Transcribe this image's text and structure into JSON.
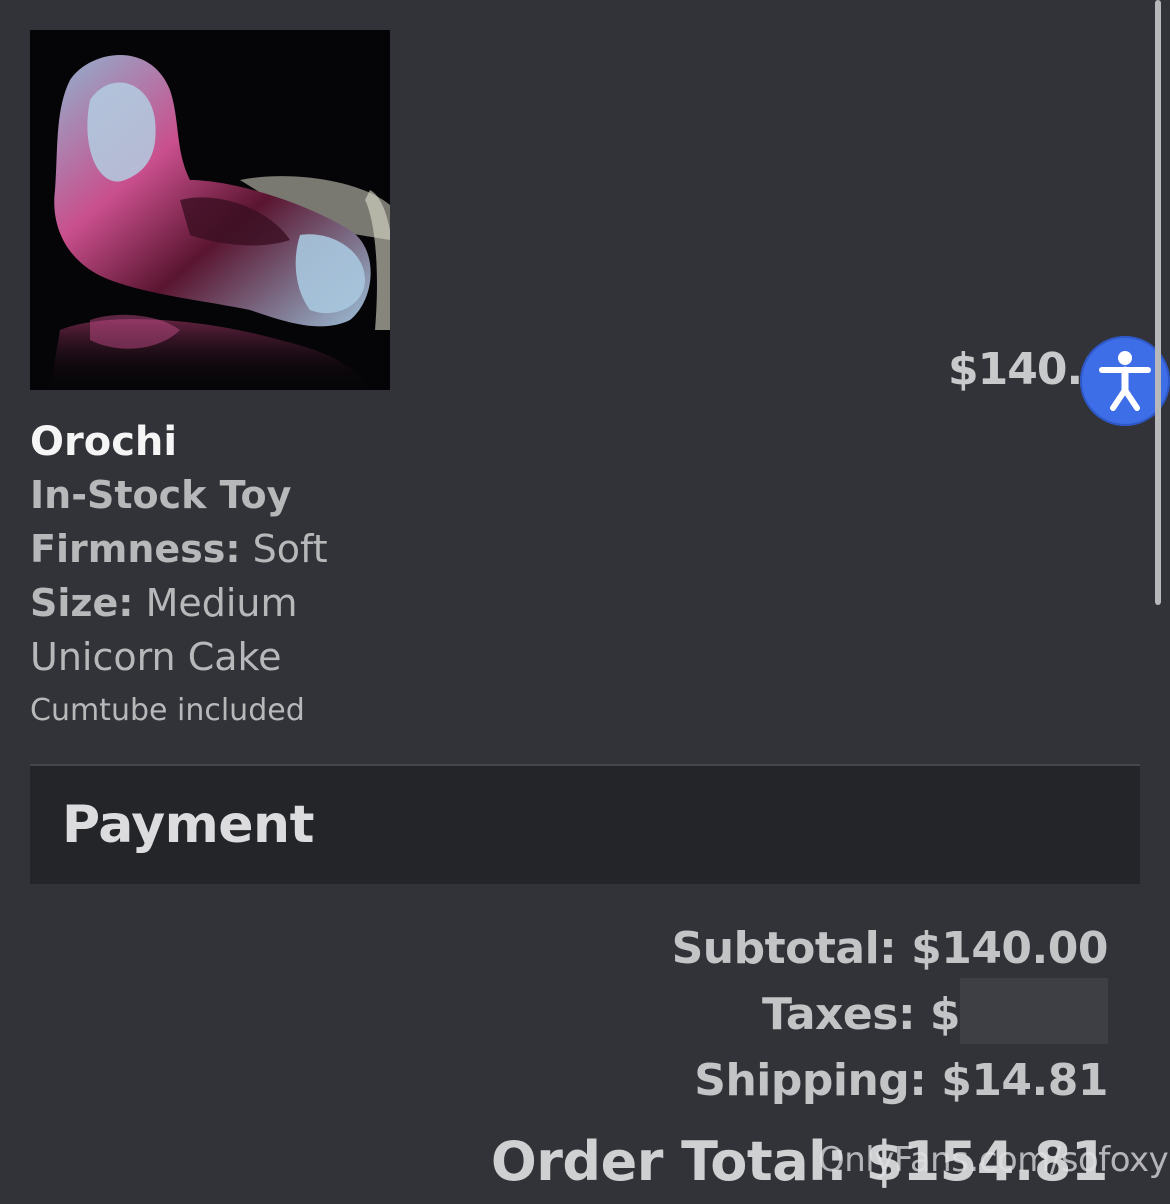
{
  "product": {
    "name": "Orochi",
    "type": "In-Stock Toy",
    "firmness_label": "Firmness:",
    "firmness_value": "Soft",
    "size_label": "Size:",
    "size_value": "Medium",
    "color": "Unicorn Cake",
    "note": "Cumtube included",
    "price": "$140.0",
    "image_icon": "product-photo"
  },
  "payment": {
    "title": "Payment",
    "subtotal": "Subtotal: $140.00",
    "taxes_label": "Taxes: $",
    "shipping": "Shipping: $14.81",
    "order_total": "Order Total: $154.81"
  },
  "accessibility": {
    "icon": "accessibility-icon",
    "color": "#3d6ee8"
  },
  "watermark": "OnlyFans.com/sofoxy",
  "colors": {
    "background": "#313338",
    "header": "#232529",
    "text": "#c7c8ca"
  }
}
